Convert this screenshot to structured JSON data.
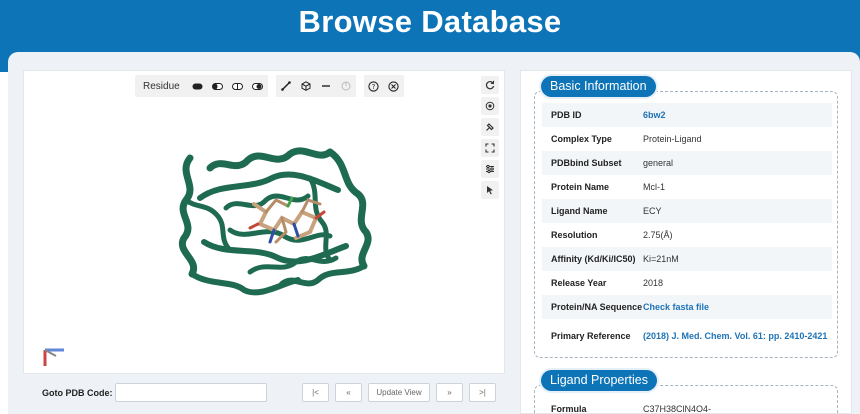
{
  "header": {
    "title": "Browse Database"
  },
  "viewer": {
    "toolbar": {
      "label": "Residue",
      "icons": [
        "style-cartoon-icon",
        "style-half-icon",
        "style-outline-icon",
        "style-dot-icon",
        "measure-icon",
        "cube-icon",
        "minus-icon",
        "disabled-circle-icon",
        "help-icon",
        "close-icon"
      ]
    },
    "side_icons": [
      "rotate-icon",
      "target-icon",
      "paint-icon",
      "fullscreen-icon",
      "settings-icon",
      "cursor-icon"
    ]
  },
  "goto": {
    "label": "Goto PDB Code:",
    "input_value": "",
    "first_btn": "|<",
    "prev_btn": "«",
    "update_btn": "Update View",
    "next_btn": "»",
    "last_btn": ">|"
  },
  "basic_info": {
    "title": "Basic Information",
    "rows": [
      {
        "key": "PDB ID",
        "value": "6bw2",
        "link": true
      },
      {
        "key": "Complex Type",
        "value": "Protein-Ligand",
        "link": false
      },
      {
        "key": "PDBbind Subset",
        "value": "general",
        "link": false
      },
      {
        "key": "Protein Name",
        "value": "Mcl-1",
        "link": false
      },
      {
        "key": "Ligand Name",
        "value": "ECY",
        "link": false
      },
      {
        "key": "Resolution",
        "value": "2.75(Å)",
        "link": false
      },
      {
        "key": "Affinity (Kd/Ki/IC50)",
        "value": "Ki=21nM",
        "link": false
      },
      {
        "key": "Release Year",
        "value": "2018",
        "link": false
      },
      {
        "key": "Protein/NA Sequence",
        "value": "Check fasta file",
        "link": true
      },
      {
        "key": "Primary Reference",
        "value": "(2018) J. Med. Chem. Vol. 61: pp. 2410-2421",
        "link": true
      }
    ]
  },
  "ligand_props": {
    "title": "Ligand Properties",
    "rows": [
      {
        "key": "Formula",
        "value": "C37H38ClN4O4-"
      }
    ]
  },
  "colors": {
    "brand": "#0e74b8",
    "protein": "#1f6b52",
    "link": "#1e73b6"
  }
}
